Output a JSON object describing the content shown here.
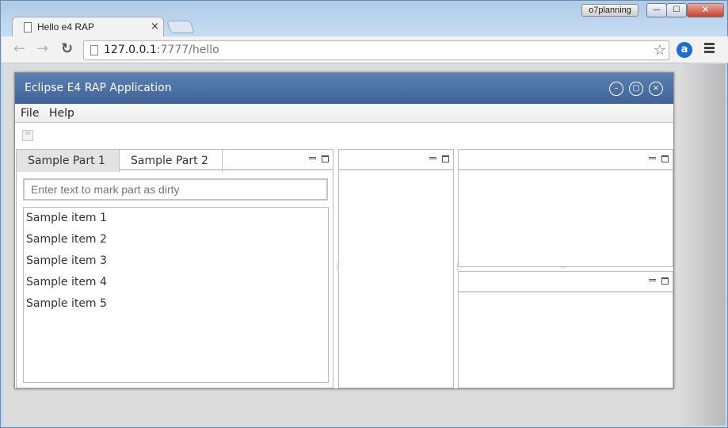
{
  "browser": {
    "user_badge": "o7planning",
    "window_buttons": {
      "minimize": "—",
      "maximize": "☐",
      "close": "✕"
    },
    "tab": {
      "title": "Hello e4 RAP",
      "close": "×"
    },
    "url": {
      "host": "127.0.0.1",
      "rest": ":7777/hello"
    },
    "nav": {
      "back": "←",
      "forward": "→",
      "reload": "↻",
      "star": "☆",
      "extension": "a"
    }
  },
  "app": {
    "title": "Eclipse E4 RAP Application",
    "title_buttons": {
      "minimize": "–",
      "maximize": "▢",
      "close": "×"
    },
    "menu": [
      "File",
      "Help"
    ],
    "left_stack": {
      "tabs": [
        "Sample Part 1",
        "Sample Part 2"
      ],
      "input_placeholder": "Enter text to mark part as dirty",
      "items": [
        "Sample item 1",
        "Sample item 2",
        "Sample item 3",
        "Sample item 4",
        "Sample item 5"
      ]
    },
    "sash_glyph": "⋮",
    "sash_h_glyph": "···"
  },
  "colors": {
    "titlebar": "#4a6fa5",
    "accent": "#1b6fd1"
  }
}
